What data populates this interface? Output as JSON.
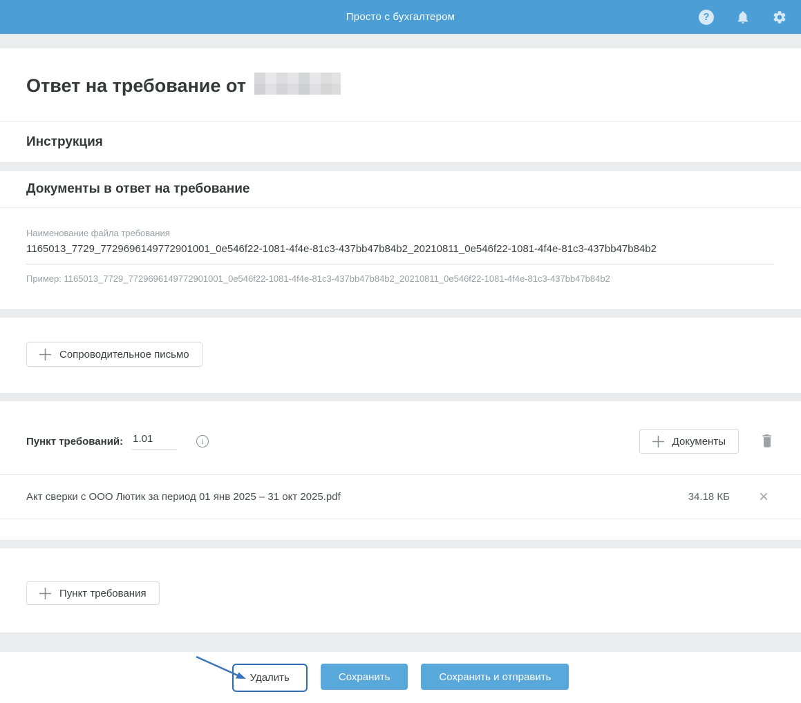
{
  "header": {
    "app_title": "Просто с бухгалтером",
    "help_glyph": "?"
  },
  "page": {
    "title_prefix": "Ответ на требование от"
  },
  "instruction": {
    "heading": "Инструкция"
  },
  "docs": {
    "heading": "Документы в ответ на требование",
    "filename": {
      "label": "Наименование файла требования",
      "value": "1165013_7729_7729696149772901001_0e546f22-1081-4f4e-81c3-437bb47b84b2_20210811_0e546f22-1081-4f4e-81c3-437bb47b84b2",
      "hint": "Пример: 1165013_7729_7729696149772901001_0e546f22-1081-4f4e-81c3-437bb47b84b2_20210811_0e546f22-1081-4f4e-81c3-437bb47b84b2"
    },
    "cover_letter_button": "Сопроводительное письмо",
    "item": {
      "label": "Пункт требований:",
      "point_value": "1.01",
      "info_glyph": "i",
      "documents_button": "Документы",
      "file_name": "Акт сверки с ООО Лютик за период 01 янв 2025 – 31 окт 2025.pdf",
      "file_size": "34.18 КБ",
      "remove_glyph": "×"
    },
    "add_point_button": "Пункт требования"
  },
  "footer": {
    "delete": "Удалить",
    "save": "Сохранить",
    "save_and_send": "Сохранить и отправить"
  },
  "colors": {
    "header_blue": "#4b9fd6",
    "button_blue": "#58a8dc",
    "annotation_blue": "#2e6cb5",
    "band_gray": "#eaecee"
  }
}
